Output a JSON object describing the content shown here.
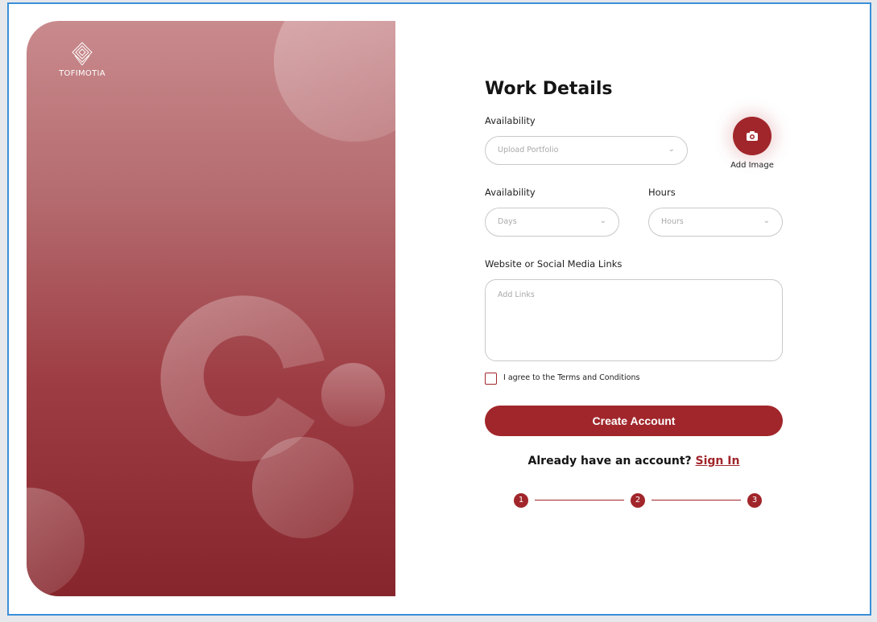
{
  "brand": {
    "name": "TOFIMOTIA"
  },
  "form": {
    "title": "Work Details",
    "portfolio": {
      "label": "Availability",
      "placeholder": "Upload Portfolio"
    },
    "add_image_label": "Add Image",
    "availability": {
      "label": "Availability",
      "placeholder": "Days"
    },
    "hours": {
      "label": "Hours",
      "placeholder": "Hours"
    },
    "links": {
      "label": "Website or Social Media Links",
      "placeholder": "Add Links"
    },
    "terms": {
      "label": "I agree to the Terms and Conditions",
      "checked": false
    },
    "create_button": "Create Account",
    "signin_prompt": "Already have an account?",
    "signin_link": "Sign In"
  },
  "steps": [
    "1",
    "2",
    "3"
  ],
  "colors": {
    "accent": "#a1262b",
    "frame_border": "#3a8fd9"
  },
  "icons": {
    "camera": "camera-icon",
    "chevron": "chevron-down-icon",
    "logo": "diamond-logo-icon"
  }
}
